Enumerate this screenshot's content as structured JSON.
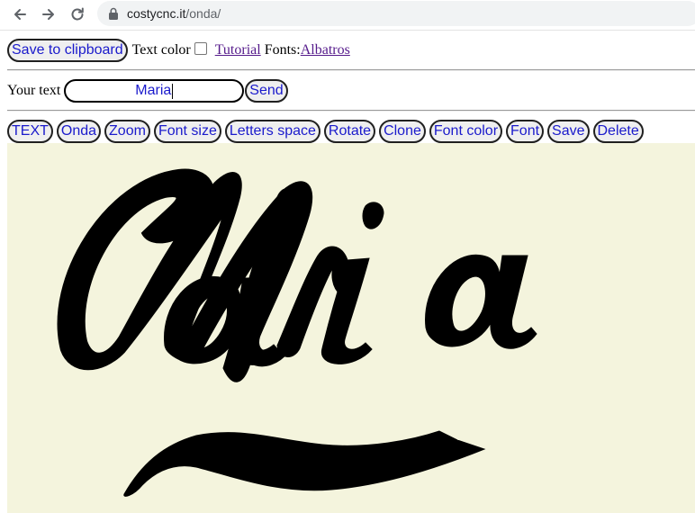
{
  "browser": {
    "url_host": "costycnc.it",
    "url_path": "/onda/"
  },
  "toolbar": {
    "save_clipboard_label": "Save to clipboard",
    "text_color_label": "Text color",
    "text_color_checked": false,
    "tutorial_label": "Tutorial",
    "fonts_label": "Fonts:",
    "font_name": "Albatros"
  },
  "text_row": {
    "label": "Your text",
    "value": "Maria",
    "send_label": "Send"
  },
  "actions": [
    {
      "name": "text-button",
      "label": "TEXT"
    },
    {
      "name": "onda-button",
      "label": "Onda"
    },
    {
      "name": "zoom-button",
      "label": "Zoom"
    },
    {
      "name": "font-size-button",
      "label": "Font size"
    },
    {
      "name": "letters-space-button",
      "label": "Letters space"
    },
    {
      "name": "rotate-button",
      "label": "Rotate"
    },
    {
      "name": "clone-button",
      "label": "Clone"
    },
    {
      "name": "font-color-button",
      "label": "Font color"
    },
    {
      "name": "font-button",
      "label": "Font"
    },
    {
      "name": "save-button",
      "label": "Save"
    },
    {
      "name": "delete-button",
      "label": "Delete"
    }
  ],
  "canvas": {
    "background": "#f4f4dd",
    "ink": "#000000",
    "rendered_text": "Maria"
  }
}
